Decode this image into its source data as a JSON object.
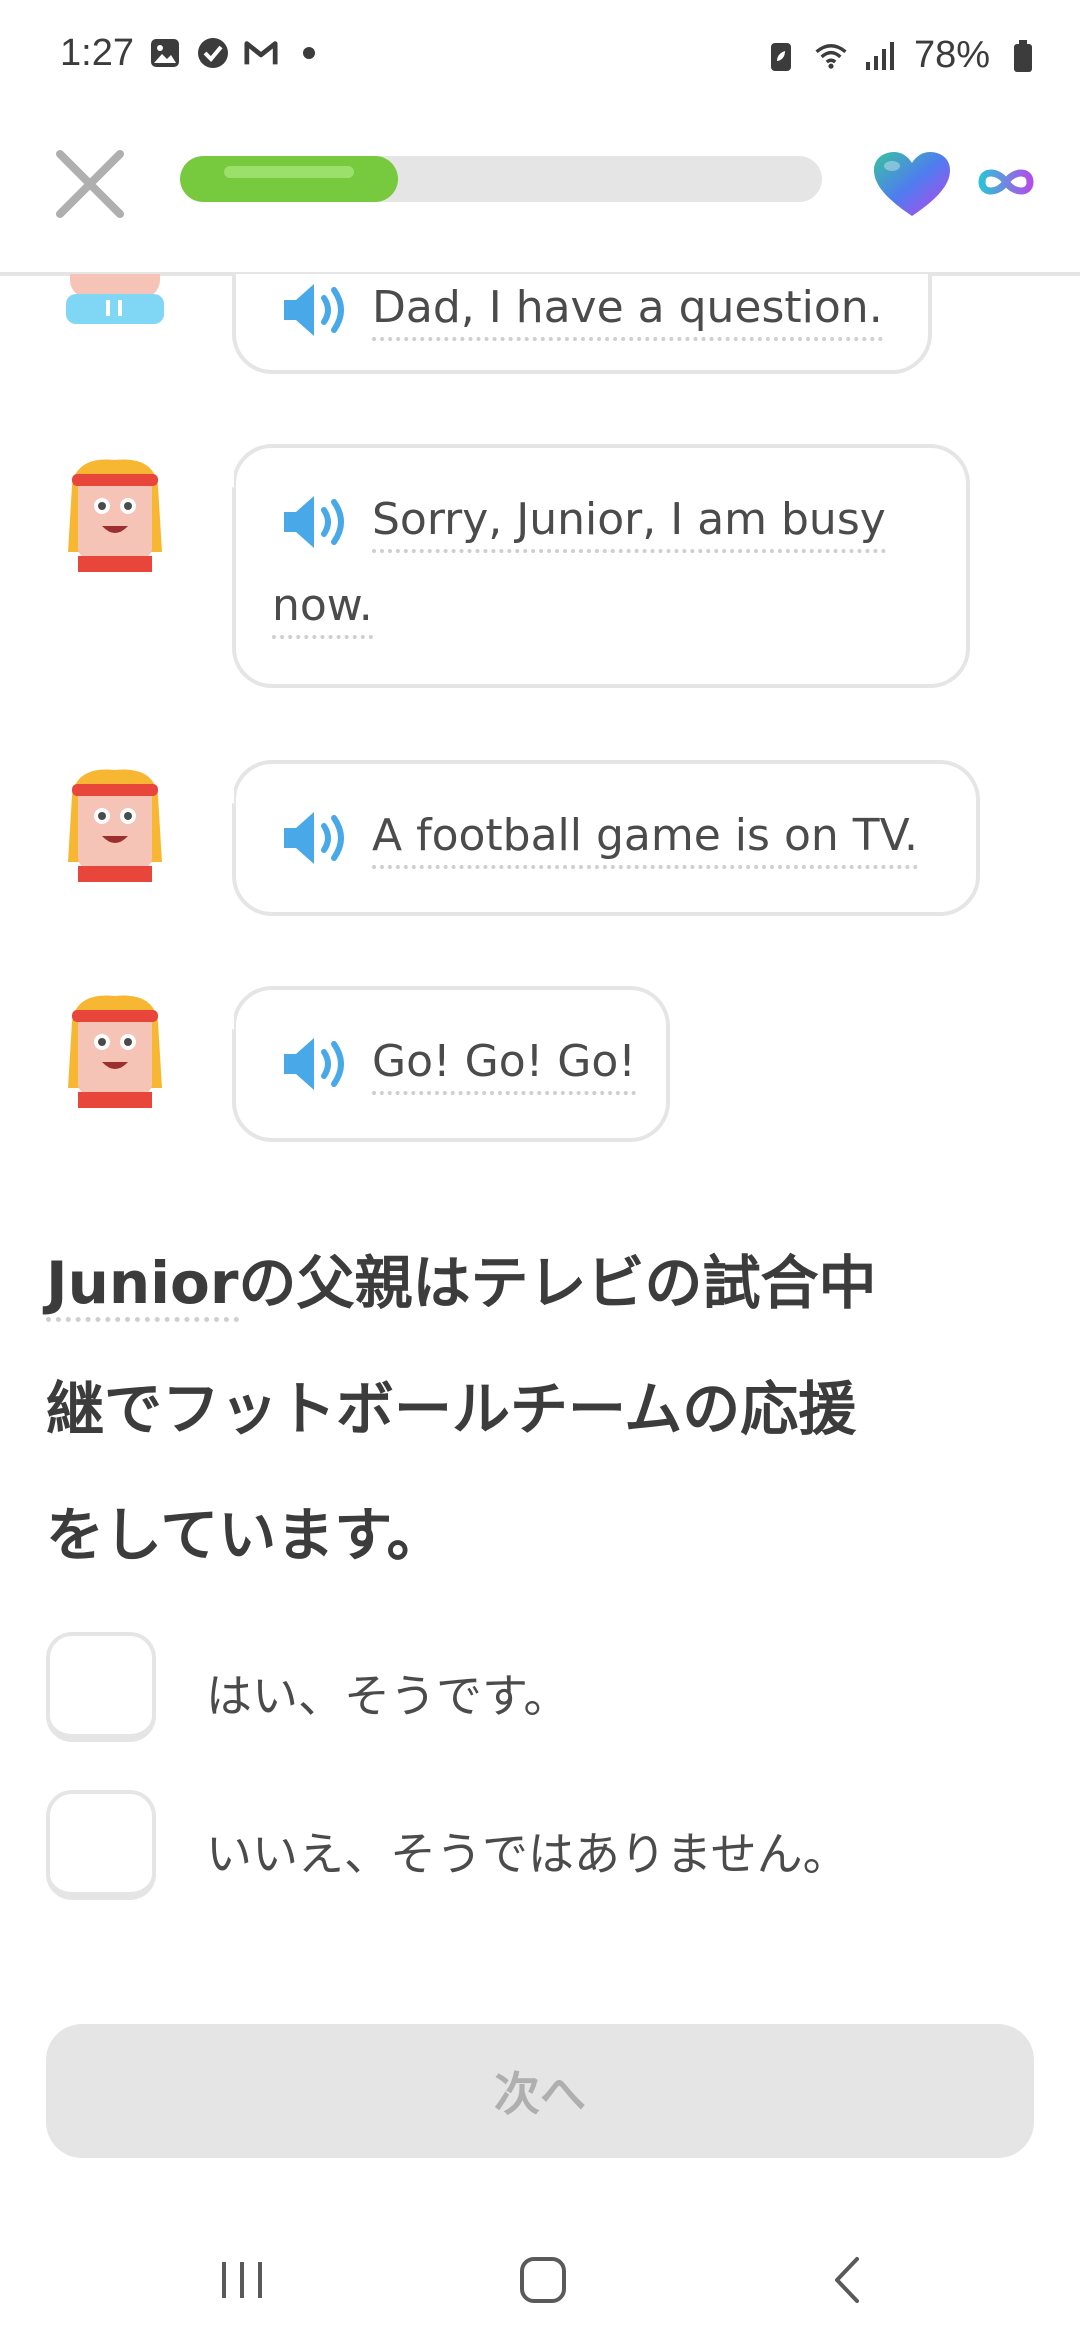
{
  "status_bar": {
    "time": "1:27",
    "battery": "78%"
  },
  "header": {
    "progress": 0.34,
    "hearts": "∞"
  },
  "conversation": [
    {
      "text": "Dad, I have a question.",
      "character": "junior"
    },
    {
      "text": "Sorry, Junior, I am busy",
      "text2": "now.",
      "character": "dad"
    },
    {
      "text": "A football game is on TV.",
      "character": "dad"
    },
    {
      "text": "Go! Go! Go!",
      "character": "dad"
    }
  ],
  "question": {
    "highlight": "Junior",
    "rest_line1": "の父親はテレビの試合中",
    "line2": "継でフットボールチームの応援",
    "line3": "をしています。"
  },
  "options": [
    {
      "label": "はい、そうです。"
    },
    {
      "label": "いいえ、そうではありません。"
    }
  ],
  "next_button": "次へ",
  "colors": {
    "progress_green": "#77c93d",
    "speaker_blue": "#49a8e8",
    "border_gray": "#e5e5e5"
  }
}
